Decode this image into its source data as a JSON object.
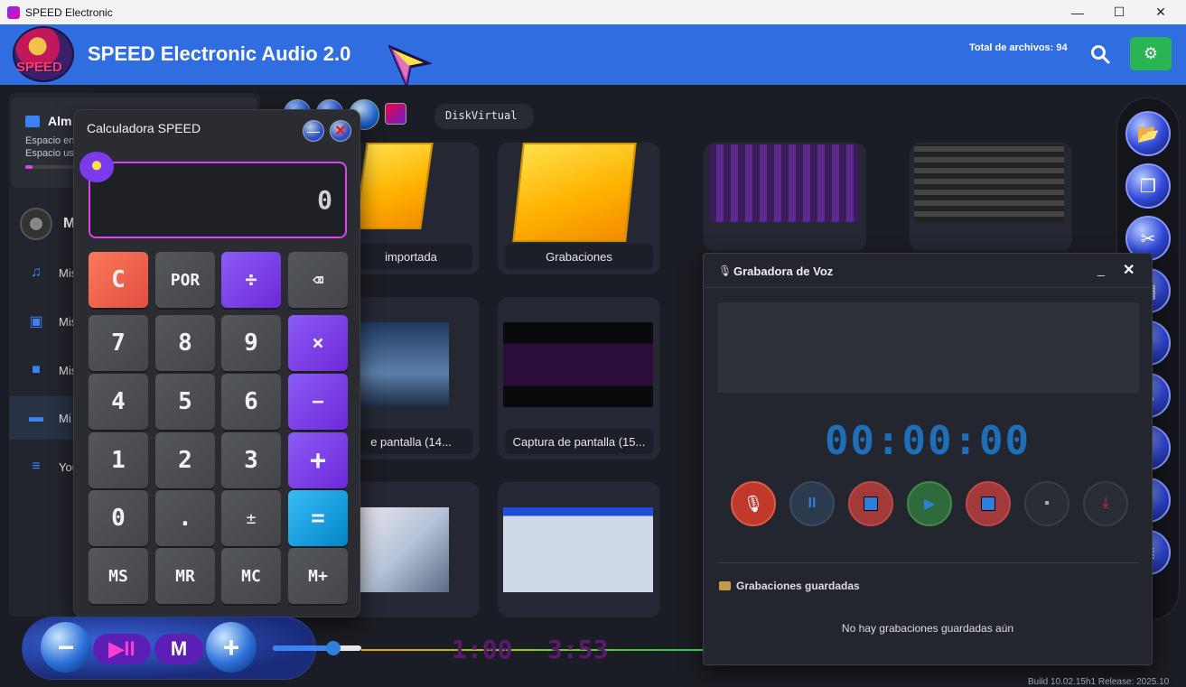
{
  "window": {
    "title": "SPEED Electronic",
    "minimize": "—",
    "maximize": "☐",
    "close": "✕"
  },
  "header": {
    "logo_text": "SPEED",
    "app_title": "SPEED Electronic Audio 2.0",
    "total_files_label": "Total de archivos: 94",
    "settings_icon": "gear-icon",
    "search_icon": "search-icon"
  },
  "sidebar": {
    "storage_title": "Alm",
    "storage_line1": "Espacio en",
    "storage_line2": "Espacio us",
    "storage_used_fraction": 0.1,
    "user_name": "M",
    "items": [
      {
        "label": "Mis",
        "icon": "music-note-icon"
      },
      {
        "label": "Mis",
        "icon": "image-icon"
      },
      {
        "label": "Mis",
        "icon": "video-camera-icon"
      },
      {
        "label": "Mi",
        "icon": "folder-icon",
        "active": true
      },
      {
        "label": "You",
        "icon": "server-icon"
      }
    ]
  },
  "main": {
    "path": "DiskVirtual",
    "cards": [
      {
        "label": "importada"
      },
      {
        "label": "Grabaciones"
      },
      {
        "label": "e pantalla (14..."
      },
      {
        "label": "Captura de pantalla (15..."
      }
    ]
  },
  "calculator": {
    "title": "Calculadora SPEED",
    "display": "0",
    "minimize": "—",
    "close": "✕",
    "keys": [
      [
        "C",
        "POR",
        "÷",
        "⌫"
      ],
      [
        "7",
        "8",
        "9",
        "×"
      ],
      [
        "4",
        "5",
        "6",
        "−"
      ],
      [
        "1",
        "2",
        "3",
        "+"
      ],
      [
        "0",
        ".",
        "±",
        "="
      ],
      [
        "MS",
        "MR",
        "MC",
        "M+"
      ]
    ]
  },
  "recorder": {
    "title": "Grabadora de Voz",
    "minimize": "_",
    "close": "✕",
    "timer": "00:00:00",
    "saved_title": "Grabaciones guardadas",
    "empty_text": "No hay grabaciones guardadas aún"
  },
  "player": {
    "minus": "−",
    "play_pause": "▶II",
    "mode": "M",
    "plus": "+",
    "volume_fraction": 0.68,
    "time_current": "1:00",
    "time_total": "3:53"
  },
  "footer": {
    "build": "Build 10.02.15h1 Release: 2025.10"
  }
}
